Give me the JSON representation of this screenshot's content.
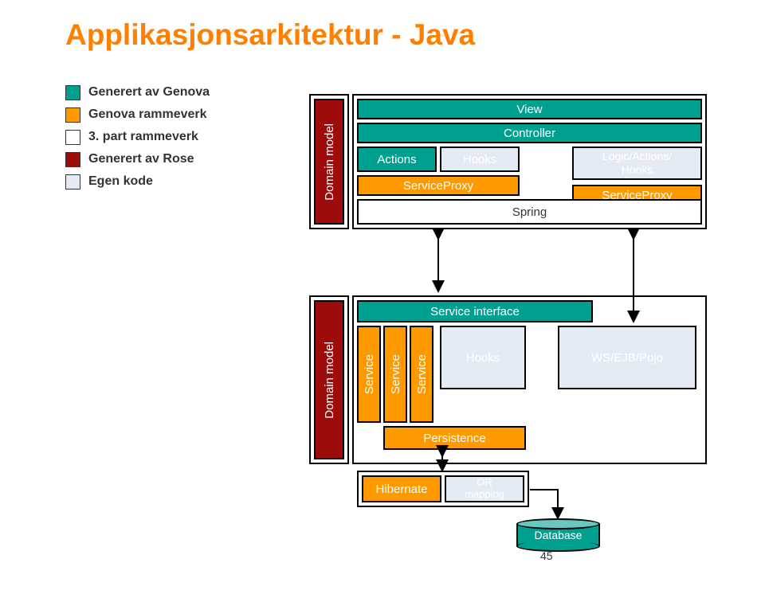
{
  "title": "Applikasjonsarkitektur - Java",
  "legend": {
    "l1": "Generert av Genova",
    "l2": "Genova rammeverk",
    "l3": "3. part rammeverk",
    "l4": "Generert av Rose",
    "l5": "Egen kode"
  },
  "arch": {
    "domain_model_top": "Domain model",
    "view": "View",
    "controller": "Controller",
    "actions": "Actions",
    "hooks_top": "Hooks",
    "logic_actions_hooks_a": "Logic/Actions/",
    "logic_actions_hooks_b": "Hooks",
    "service_proxy_l": "ServiceProxy",
    "service_proxy_r": "ServiceProxy",
    "spring": "Spring",
    "service_interface": "Service interface",
    "domain_model_bot": "Domain model",
    "service1": "Service",
    "service2": "Service",
    "service3": "Service",
    "hooks_bot": "Hooks",
    "persistence": "Persistence",
    "hibernate": "Hibernate",
    "or_mapping_a": "OR",
    "or_mapping_b": "mapping",
    "ws_ejb_pojo": "WS/EJB/Pojo",
    "database": "Database"
  },
  "page": "45"
}
